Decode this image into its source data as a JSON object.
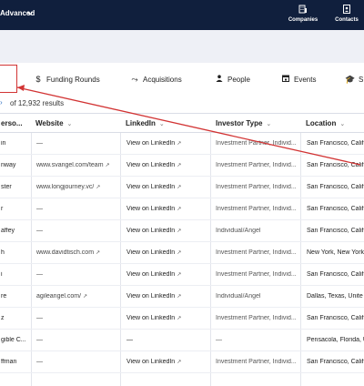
{
  "topbar": {
    "product": "Advanced",
    "nav": [
      {
        "label": "Companies",
        "icon": "building-icon"
      },
      {
        "label": "Contacts",
        "icon": "contacts-icon"
      }
    ]
  },
  "tabs": [
    {
      "label": "Funding Rounds",
      "icon": "dollar-icon"
    },
    {
      "label": "Acquisitions",
      "icon": "acquisition-arrows-icon"
    },
    {
      "label": "People",
      "icon": "person-icon"
    },
    {
      "label": "Events",
      "icon": "calendar-icon"
    },
    {
      "label": "S",
      "icon": "graduation-cap-icon"
    }
  ],
  "results": {
    "text": "of 12,932 results"
  },
  "columns": [
    "erso...",
    "Website",
    "LinkedIn",
    "Investor Type",
    "Location"
  ],
  "rows": [
    {
      "name": "in",
      "website": "—",
      "linkedin": "View on LinkedIn",
      "type": "Investment Partner, Individ...",
      "location": "San Francisco, Califo"
    },
    {
      "name": "nway",
      "website": "www.svangel.com/team",
      "linkedin": "View on LinkedIn",
      "type": "Investment Partner, Individ...",
      "location": "San Francisco, Califo"
    },
    {
      "name": "ster",
      "website": "www.longjourney.vc/",
      "linkedin": "View on LinkedIn",
      "type": "Investment Partner, Individ...",
      "location": "San Francisco, Califo"
    },
    {
      "name": "r",
      "website": "—",
      "linkedin": "View on LinkedIn",
      "type": "Investment Partner, Individ...",
      "location": "San Francisco, Califo"
    },
    {
      "name": "affey",
      "website": "—",
      "linkedin": "View on LinkedIn",
      "type": "Individual/Angel",
      "location": "San Francisco, Califo"
    },
    {
      "name": "h",
      "website": "www.davidtisch.com",
      "linkedin": "View on LinkedIn",
      "type": "Investment Partner, Individ...",
      "location": "New York, New York,"
    },
    {
      "name": "i",
      "website": "—",
      "linkedin": "View on LinkedIn",
      "type": "Investment Partner, Individ...",
      "location": "San Francisco, Califo"
    },
    {
      "name": "re",
      "website": "agileangel.com/",
      "linkedin": "View on LinkedIn",
      "type": "Individual/Angel",
      "location": "Dallas, Texas, Unite"
    },
    {
      "name": "z",
      "website": "—",
      "linkedin": "View on LinkedIn",
      "type": "Investment Partner, Individ...",
      "location": "San Francisco, Califo"
    },
    {
      "name": "gible C...",
      "website": "—",
      "linkedin": "—",
      "type": "—",
      "location": "Pensacola, Florida, U"
    },
    {
      "name": "ffman",
      "website": "—",
      "linkedin": "View on LinkedIn",
      "type": "Investment Partner, Individ...",
      "location": "San Francisco, Califo"
    }
  ],
  "colors": {
    "topbar": "#101f3d",
    "link": "#3b78c3",
    "annotation": "#d23434"
  }
}
